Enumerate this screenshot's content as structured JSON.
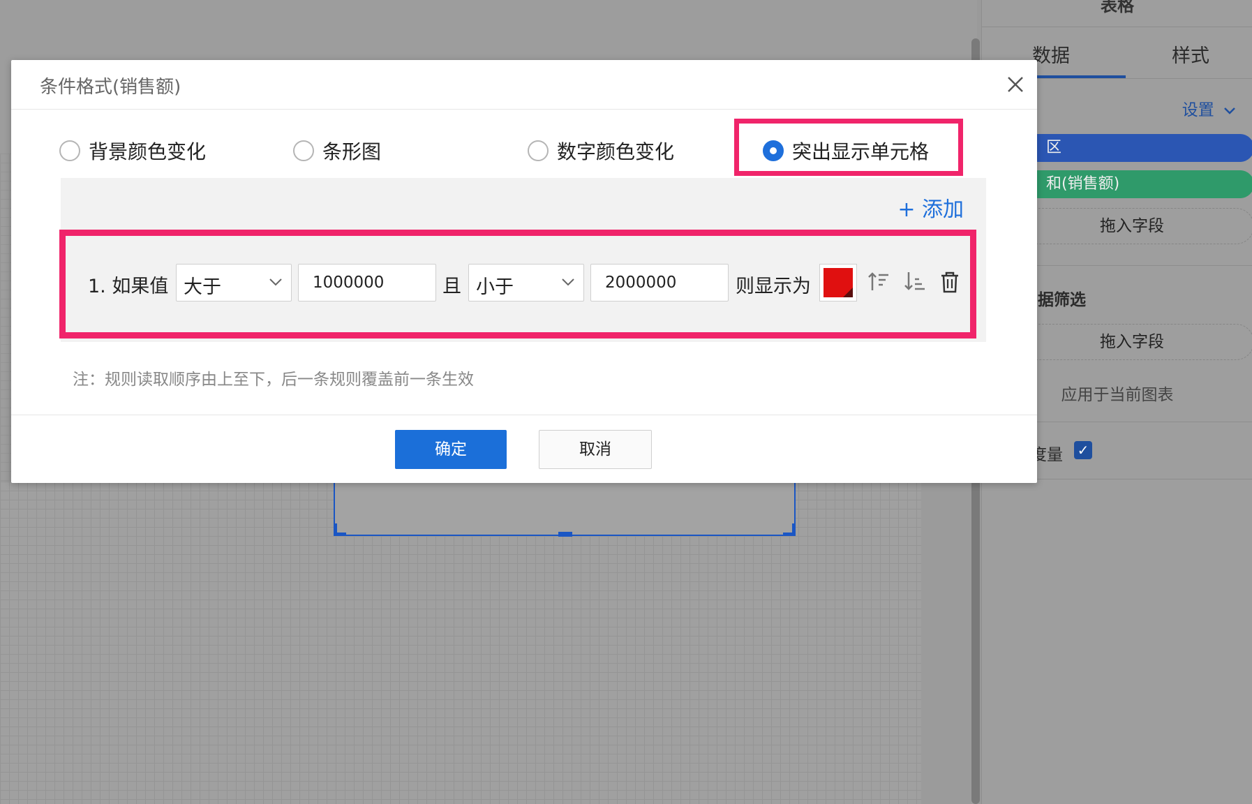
{
  "right_panel": {
    "title": "表格",
    "tabs": [
      {
        "label": "数据"
      },
      {
        "label": "样式"
      }
    ],
    "settings_link": "设置",
    "fields": [
      {
        "label": "区",
        "color": "#2b56b3"
      },
      {
        "label": "和(销售额)",
        "color": "#2f9a6a"
      }
    ],
    "drop_field_label_1": "拖入字段",
    "filter_section_label": "据筛选",
    "drop_field_label_2": "拖入字段",
    "apply_label": "应用于当前图表",
    "measure_label": "度量",
    "measure_checked": "✓"
  },
  "dialog": {
    "title": "条件格式(销售额)",
    "radio_options": [
      {
        "label": "背景颜色变化",
        "checked": false
      },
      {
        "label": "条形图",
        "checked": false
      },
      {
        "label": "数字颜色变化",
        "checked": false
      },
      {
        "label": "突出显示单元格",
        "checked": true
      }
    ],
    "add_label": "+ 添加",
    "rule": {
      "prefix": "1. 如果值",
      "op1": "大于",
      "val1": "1000000",
      "and_label": "且",
      "op2": "小于",
      "val2": "2000000",
      "then_label": "则显示为",
      "color": "#e01010"
    },
    "note": "注：规则读取顺序由上至下，后一条规则覆盖前一条生效",
    "confirm_label": "确定",
    "cancel_label": "取消"
  },
  "colors": {
    "accent": "#1e6fdb",
    "highlight_border": "#f0246a"
  }
}
